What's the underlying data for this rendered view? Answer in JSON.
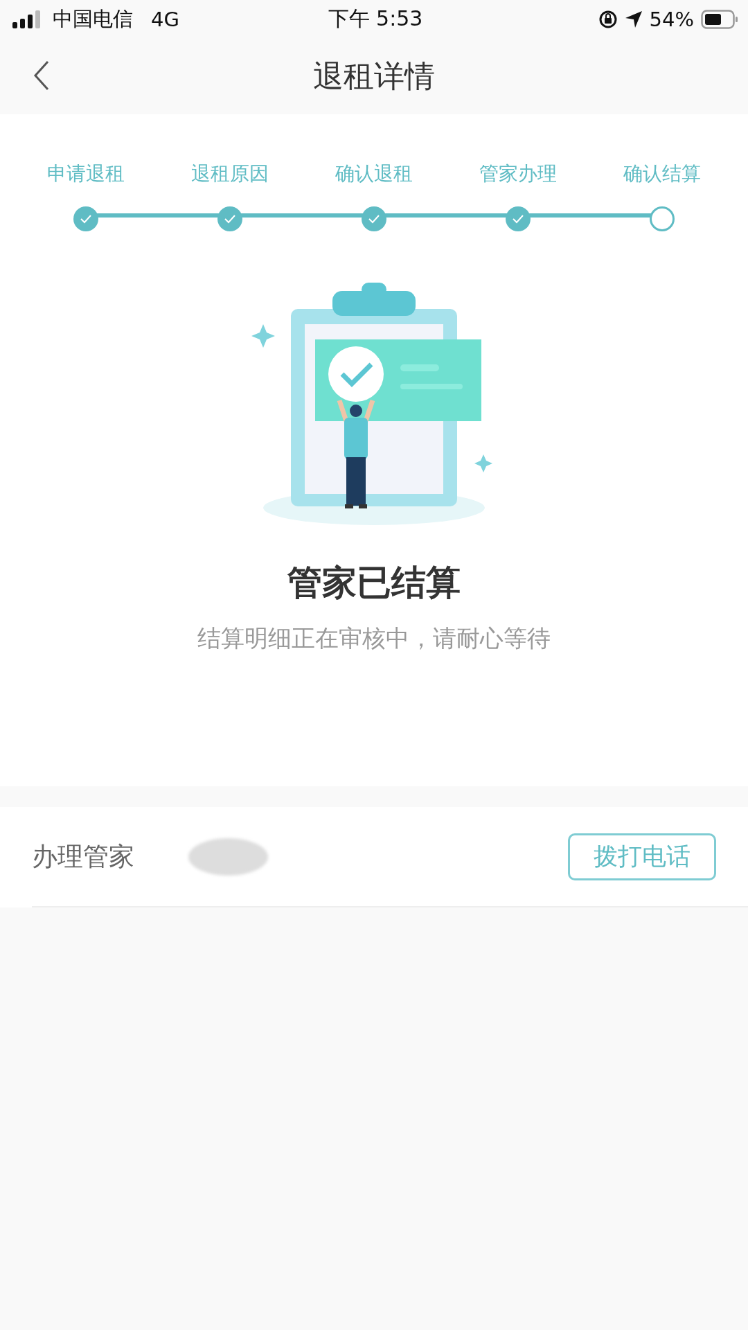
{
  "status_bar": {
    "carrier": "中国电信",
    "network": "4G",
    "time": "下午 5:53",
    "battery": "54%"
  },
  "nav": {
    "title": "退租详情"
  },
  "steps": [
    {
      "label": "申请退租",
      "done": true
    },
    {
      "label": "退租原因",
      "done": true
    },
    {
      "label": "确认退租",
      "done": true
    },
    {
      "label": "管家办理",
      "done": true
    },
    {
      "label": "确认结算",
      "done": false
    }
  ],
  "status": {
    "title": "管家已结算",
    "message": "结算明细正在审核中，请耐心等待"
  },
  "manager": {
    "label": "办理管家",
    "call_button": "拨打电话"
  }
}
